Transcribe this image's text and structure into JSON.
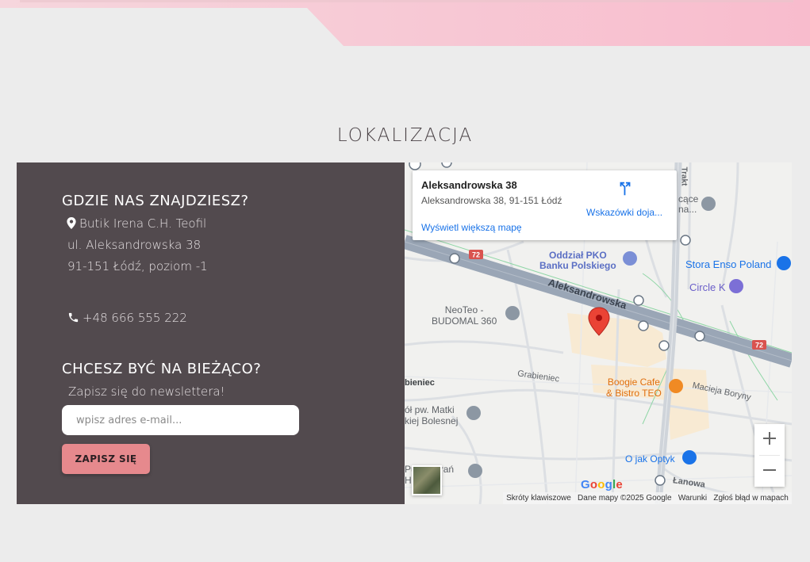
{
  "section_title": "LOKALIZACJA",
  "where": {
    "heading": "GDZIE NAS ZNAJDZIESZ?",
    "lines": [
      "Butik Irena C.H. Teofil",
      "ul. Aleksandrowska 38",
      "91-151 Łódź, poziom -1"
    ],
    "phone": "+48 666 555 222"
  },
  "newsletter": {
    "heading": "CHCESZ BYĆ NA BIEŻĄCO?",
    "subtitle": "Zapisz się do newslettera!",
    "email_placeholder": "wpisz adres e-mail...",
    "button_label": "ZAPISZ SIĘ"
  },
  "map": {
    "card": {
      "title": "Aleksandrowska 38",
      "address": "Aleksandrowska 38, 91-151 Łódź",
      "directions_label": "Wskazówki doja...",
      "larger_map_link": "Wyświetl większą mapę"
    },
    "labels": {
      "street_main": "Aleksandrowska",
      "route": "72",
      "route_2": "72",
      "pko": "Oddział PKO\nBanku Polskiego",
      "neoteo": "NeoTeo -\nBUDOMAL 360",
      "stora": "Stora Enso Poland",
      "circlek": "Circle K",
      "boogie": "Boogie Cafe\n& Bistro TEO",
      "grabieniec": "Grabieniec",
      "bieniec": "bieniec",
      "macieja": "Macieja Boryny",
      "parafia": "ół pw. Matki\nkiej Bolesnej",
      "pub": "Pub Lubrań\nHistoria",
      "optyk": "O jak Optyk",
      "lanowa": "Łanowa",
      "traktorowa": "Trakt",
      "cace": "cące\nna..."
    },
    "footer": [
      "Skróty klawiszowe",
      "Dane mapy ©2025 Google",
      "Warunki",
      "Zgłoś błąd w mapach"
    ],
    "google_logo": "Google"
  },
  "colors": {
    "panel_bg": "#524a4e",
    "button_bg": "#e6898d",
    "page_bg": "#ececec",
    "link": "#1a73e8",
    "pin": "#ea4335"
  }
}
